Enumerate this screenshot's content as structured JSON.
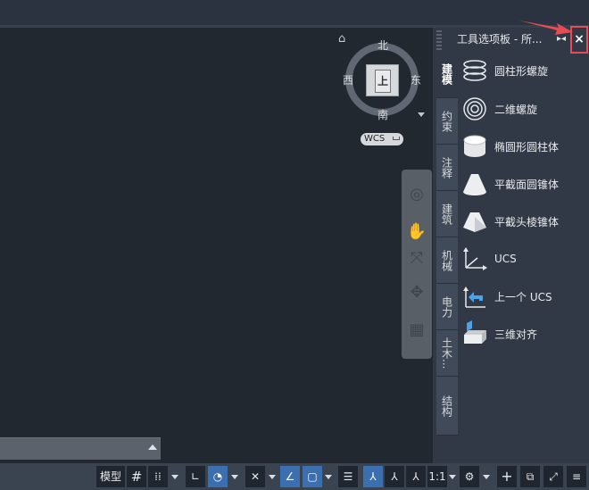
{
  "viewcube": {
    "north": "北",
    "south": "南",
    "west": "西",
    "east": "东",
    "face": "上",
    "wcs_label": "WCS"
  },
  "palette": {
    "title": "工具选项板 - 所...",
    "close_label": "×",
    "tabs": [
      "建模",
      "约束",
      "注释",
      "建筑",
      "机械",
      "电力",
      "土木...",
      "结构"
    ],
    "active_tab": "建模",
    "items": [
      {
        "label": "圆柱形螺旋",
        "icon": "helix-icon"
      },
      {
        "label": "二维螺旋",
        "icon": "spiral-icon"
      },
      {
        "label": "椭圆形圆柱体",
        "icon": "elliptical-cylinder-icon"
      },
      {
        "label": "平截面圆锥体",
        "icon": "frustum-cone-icon"
      },
      {
        "label": "平截头棱锥体",
        "icon": "frustum-pyramid-icon"
      },
      {
        "label": "UCS",
        "icon": "ucs-icon"
      },
      {
        "label": "上一个 UCS",
        "icon": "ucs-previous-icon"
      },
      {
        "label": "三维对齐",
        "icon": "3d-align-icon"
      }
    ]
  },
  "statusbar": {
    "model_label": "模型",
    "scale_label": "1:1"
  },
  "colors": {
    "drawing_bg": "#212830",
    "palette_bg": "#303945",
    "accent": "#3b6fb0",
    "highlight": "#e84b55"
  }
}
